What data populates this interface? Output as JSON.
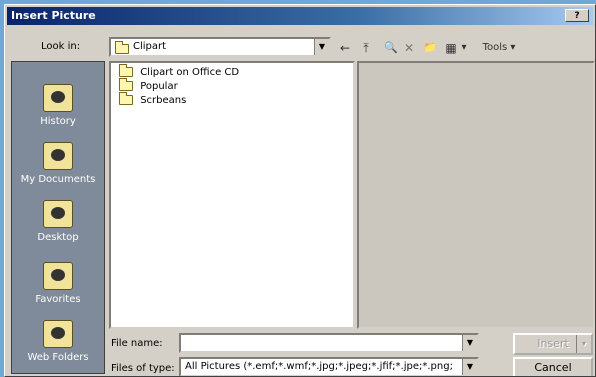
{
  "window": {
    "title": "Insert Picture",
    "help_glyph": "?"
  },
  "lookin": {
    "label": "Look in:",
    "value": "Clipart",
    "arrow": "▼"
  },
  "toolbar": {
    "back": "←",
    "up": "⤒",
    "search": "🔍",
    "delete": "✕",
    "newfolder": "📁",
    "views": "▦",
    "views_arrow": "▾",
    "tools_label": "Tools",
    "tools_arrow": "▾"
  },
  "places": [
    {
      "label": "History"
    },
    {
      "label": "My Documents"
    },
    {
      "label": "Desktop"
    },
    {
      "label": "Favorites"
    },
    {
      "label": "Web Folders"
    }
  ],
  "files": [
    {
      "name": "Clipart on Office CD"
    },
    {
      "name": "Popular"
    },
    {
      "name": "Scrbeans"
    }
  ],
  "filename": {
    "label": "File name:",
    "value": "",
    "arrow": "▼"
  },
  "filetype": {
    "label": "Files of type:",
    "value": "All Pictures (*.emf;*.wmf;*.jpg;*.jpeg;*.jfif;*.jpe;*.png;",
    "arrow": "▼"
  },
  "buttons": {
    "insert": "Insert",
    "insert_arrow": "▾",
    "cancel": "Cancel"
  }
}
